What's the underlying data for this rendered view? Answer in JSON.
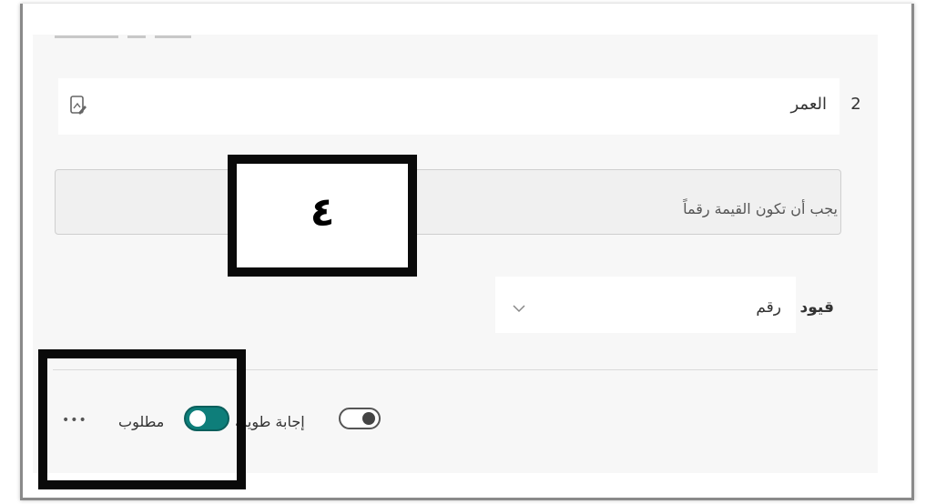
{
  "question": {
    "number": "2",
    "title": "العمر"
  },
  "validation": {
    "message": "يجب أن تكون القيمة رقماً"
  },
  "constraints": {
    "label": "قيود",
    "selected": "رقم"
  },
  "options": {
    "long_answer_label": "إجابة طويلة",
    "long_answer_on": false,
    "required_label": "مطلوب",
    "required_on": true,
    "more": "•••"
  },
  "callout_number": "٤",
  "colors": {
    "toggle_on": "#0e7e7a",
    "callout_border": "#0a0a0a"
  }
}
